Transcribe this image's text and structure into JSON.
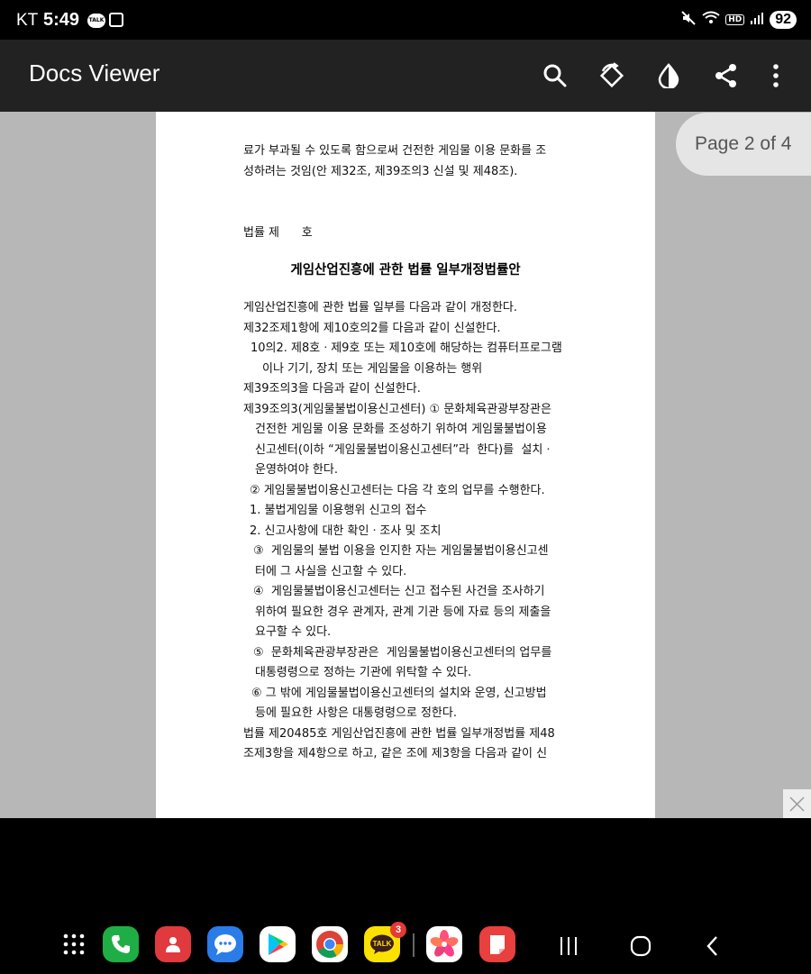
{
  "status_bar": {
    "carrier": "KT",
    "time": "5:49",
    "talk_label": "TALK",
    "hd_label": "HD",
    "battery": "92"
  },
  "app_bar": {
    "title": "Docs Viewer",
    "actions": [
      "search-icon",
      "rotate-icon",
      "contrast-icon",
      "share-icon",
      "more-vert-icon"
    ]
  },
  "document": {
    "page_indicator": "Page 2 of 4",
    "lines": [
      "료가 부과될 수 있도록 함으로써 건전한 게임물 이용 문화를 조",
      "성하려는 것임(안 제32조, 제39조의3 신설 및 제48조).",
      "법률 제      호",
      "게임산업진흥에 관한 법률 일부개정법률안",
      "게임산업진흥에 관한 법률 일부를 다음과 같이 개정한다.",
      "제32조제1항에 제10호의2를 다음과 같이 신설한다.",
      "10의2. 제8호ㆍ제9호 또는 제10호에 해당하는 컴퓨터프로그램",
      "이나 기기, 장치 또는 게임물을 이용하는 행위",
      "제39조의3을 다음과 같이 신설한다.",
      "제39조의3(게임물불법이용신고센터) ① 문화체육관광부장관은",
      "건전한 게임물 이용 문화를 조성하기 위하여 게임물불법이용",
      "신고센터(이하 “게임물불법이용신고센터”라  한다)를  설치ㆍ",
      "운영하여야 한다.",
      "② 게임물불법이용신고센터는 다음 각 호의 업무를 수행한다.",
      "1. 불법게임물 이용행위 신고의 접수",
      "2. 신고사항에 대한 확인ㆍ조사 및 조치",
      "③  게임물의 불법 이용을 인지한 자는 게임물불법이용신고센",
      "터에 그 사실을 신고할 수 있다.",
      "④  게임물불법이용신고센터는 신고 접수된 사건을 조사하기",
      "위하여 필요한 경우 관계자, 관계 기관 등에 자료 등의 제출을",
      "요구할 수 있다.",
      "⑤  문화체육관광부장관은  게임물불법이용신고센터의 업무를",
      "대통령령으로 정하는 기관에 위탁할 수 있다.",
      "⑥ 그 밖에 게임물불법이용신고센터의 설치와 운영, 신고방법",
      "등에 필요한 사항은 대통령령으로 정한다.",
      "법률 제20485호 게임산업진흥에 관한 법률 일부개정법률 제48",
      "조제3항을 제4항으로 하고, 같은 조에 제3항을 다음과 같이 신"
    ]
  },
  "dock": {
    "apps": [
      "app-drawer-icon",
      "phone-app-icon",
      "contacts-app-icon",
      "messages-app-icon",
      "play-store-app-icon",
      "chrome-app-icon",
      "kakaotalk-app-icon",
      "gallery-app-icon",
      "notes-app-icon"
    ],
    "kakaotalk_badge": "3",
    "kakaotalk_label": "TALK"
  },
  "colors": {
    "app_bar": "#222222",
    "viewer_bg": "#b7b7b7",
    "page_badge_bg": "#e5e5e5"
  }
}
